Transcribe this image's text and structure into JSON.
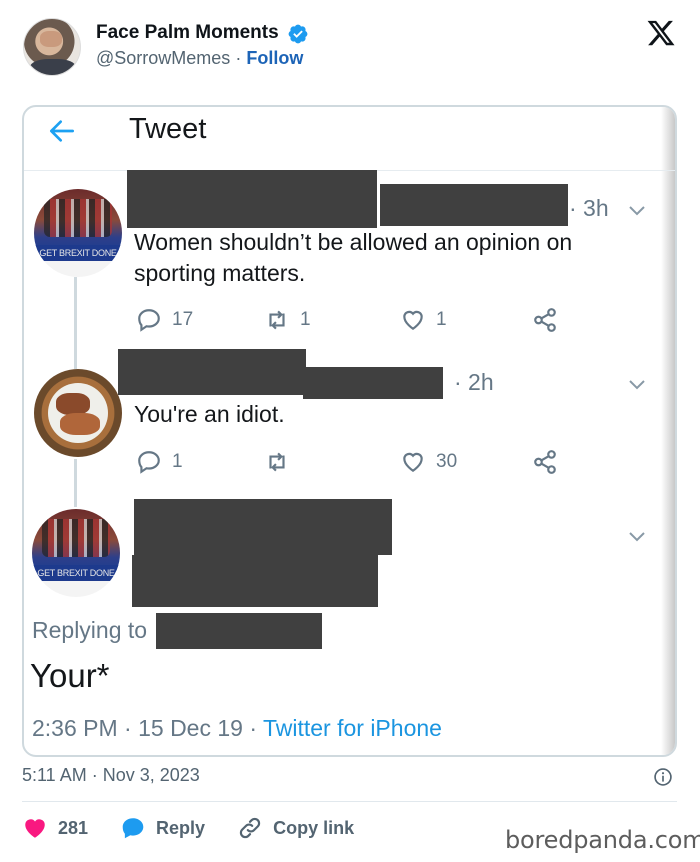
{
  "post": {
    "display_name": "Face Palm Moments",
    "handle": "@SorrowMemes",
    "separator": "·",
    "follow_label": "Follow",
    "timestamp": "5:11 AM · Nov 3, 2023",
    "likes": "281",
    "reply_label": "Reply",
    "copy_link_label": "Copy link",
    "colors": {
      "verified": "#1d9bf0",
      "follow": "#1d64b7",
      "like": "#f91880",
      "reply": "#1d9bf0"
    }
  },
  "screenshot": {
    "title": "Tweet",
    "tweets": [
      {
        "time": "· 3h",
        "text_line1": "Women shouldn’t be allowed an opinion on",
        "text_line2": "sporting matters.",
        "avatar_banner": "GET BREXIT DONE",
        "replies": "17",
        "retweets": "1",
        "likes": "1"
      },
      {
        "time": "· 2h",
        "text": "You're an idiot.",
        "replies": "1",
        "retweets": "",
        "likes": "30"
      },
      {
        "avatar_banner": "GET BREXIT DONE"
      }
    ],
    "replying_to_label": "Replying to",
    "reply_text": "Your*",
    "footer_time": "2:36 PM · 15 Dec 19 · ",
    "footer_source": "Twitter for iPhone"
  },
  "watermark": "boredpanda.com"
}
